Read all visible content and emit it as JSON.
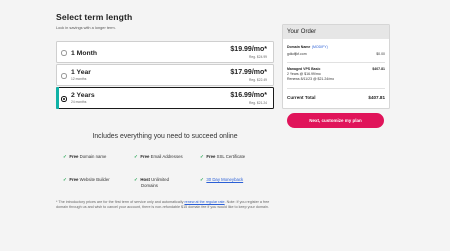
{
  "heading": "Select term length",
  "subheading": "Lock in savings with a longer term.",
  "terms": [
    {
      "name": "1 Month",
      "months": "",
      "price": "$19.99/mo*",
      "regular": "Reg. $24.99",
      "selected": false
    },
    {
      "name": "1 Year",
      "months": "12 months",
      "price": "$17.99/mo*",
      "regular": "Reg. $22.49",
      "selected": false
    },
    {
      "name": "2 Years",
      "months": "24 months",
      "price": "$16.99/mo*",
      "regular": "Reg. $21.24",
      "selected": true
    }
  ],
  "includes_title": "Includes everything you need to succeed online",
  "features": [
    {
      "free": "Free",
      "label": " Domain name"
    },
    {
      "free": "Free",
      "label": " Email Addresses"
    },
    {
      "free": "Free",
      "label": " SSL Certificate"
    },
    {
      "free": "Free",
      "label": " Website Builder"
    },
    {
      "free": "Host",
      "label": " Unlimited",
      "label2": "Domains"
    },
    {
      "free": "",
      "label": "30 Day Moneyback"
    }
  ],
  "footnote": {
    "part1": "* The introductory prices are for the first term of service only and automatically ",
    "link": "renew at the regular rate",
    "part2": ". Note: If you register a free domain through us and wish to cancel your account, there is non-refundable $15 domain fee if you would like to keep your domain."
  },
  "order": {
    "title": "Your Order",
    "domain_label": "Domain Name",
    "modify": "(MODIFY)",
    "domain": "gdkdfjkf.com",
    "domain_price": "$0.00",
    "plan_name": "Managed VPS Basic",
    "plan_term": "2 Years @ $16.99/mo",
    "plan_renew": "Renews 8/11/23 @ $21.24/mo",
    "plan_price": "$407.81",
    "total_label": "Current Total",
    "total": "$407.81"
  },
  "cta": "Next, customize my plan",
  "colors": {
    "accent": "#e0145a",
    "selected": "#10b2a6",
    "check": "#1aa34a",
    "link": "#2a5fd6"
  }
}
